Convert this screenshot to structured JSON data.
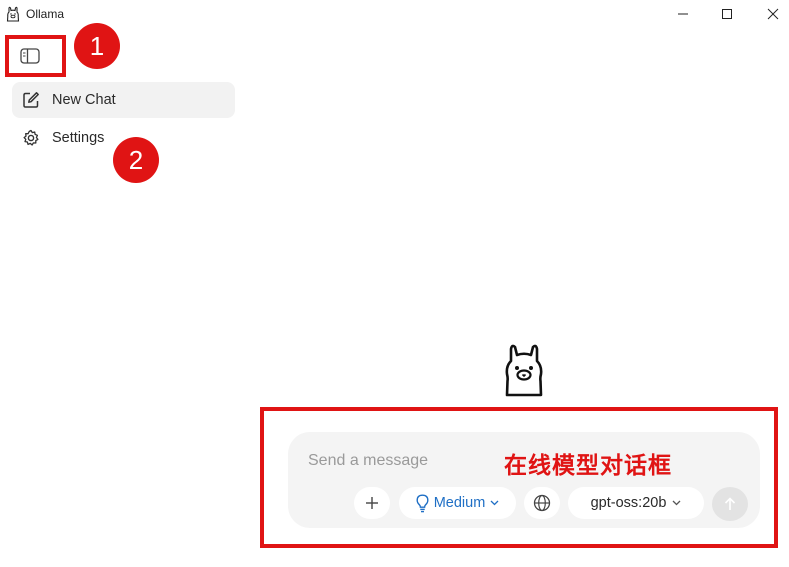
{
  "window": {
    "title": "Ollama",
    "controls": {
      "minimize": "minimize-icon",
      "maximize": "maximize-icon",
      "close": "close-icon"
    }
  },
  "sidebar": {
    "toggle_icon": "sidebar-toggle-icon",
    "items": [
      {
        "label": "New Chat",
        "icon": "compose-icon",
        "active": true
      },
      {
        "label": "Settings",
        "icon": "gear-icon",
        "active": false
      }
    ]
  },
  "main": {
    "logo": "ollama-llama-logo",
    "composer": {
      "placeholder": "Send a message",
      "value": "",
      "add_icon": "plus-icon",
      "think_level": "Medium",
      "think_icon": "lightbulb-icon",
      "web_icon": "globe-icon",
      "model": "gpt-oss:20b",
      "send_icon": "arrow-up-icon"
    }
  },
  "annotations": {
    "marker_1": "1",
    "marker_2": "2",
    "composer_caption": "在线模型对话框",
    "color": "#e01414"
  },
  "colors": {
    "think_accent": "#1f6fc5",
    "active_item_bg": "#f2f2f2",
    "composer_bg": "#f4f4f4"
  }
}
